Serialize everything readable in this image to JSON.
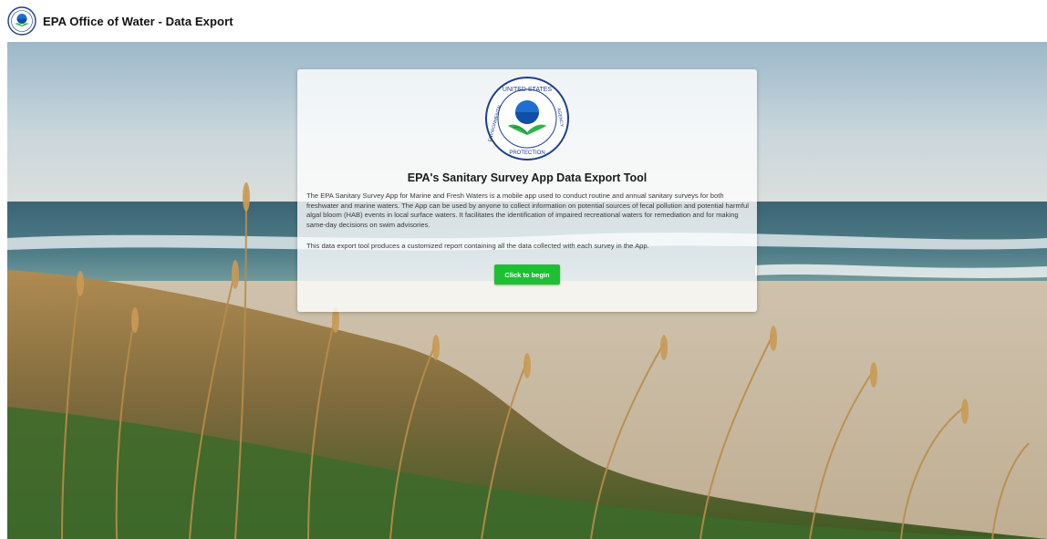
{
  "header": {
    "title": "EPA Office of Water - Data Export",
    "logo_icon": "epa-seal-icon"
  },
  "card": {
    "seal_icon": "epa-seal-icon",
    "seal_text_top": "UNITED STATES",
    "seal_text_left": "ENVIRONMENTAL",
    "seal_text_bottom": "PROTECTION",
    "seal_text_right": "AGENCY",
    "heading": "EPA's Sanitary Survey App Data Export Tool",
    "description": "The EPA Sanitary Survey App for Marine and Fresh Waters is a mobile app used to conduct routine and annual sanitary surveys for both freshwater and marine waters. The App can be used by anyone to collect information on potential sources of fecal pollution and potential harmful algal bloom (HAB) events in local surface waters. It facilitates the identification of impaired recreational waters for remediation and for making same-day decisions on swim advisories.",
    "export_note": "This data export tool produces a customized report containing all the data collected with each survey in the App.",
    "begin_button_label": "Click to begin",
    "accent_color": "#1fbf32"
  },
  "background": {
    "scene": "beach-with-sea-oats-image"
  }
}
